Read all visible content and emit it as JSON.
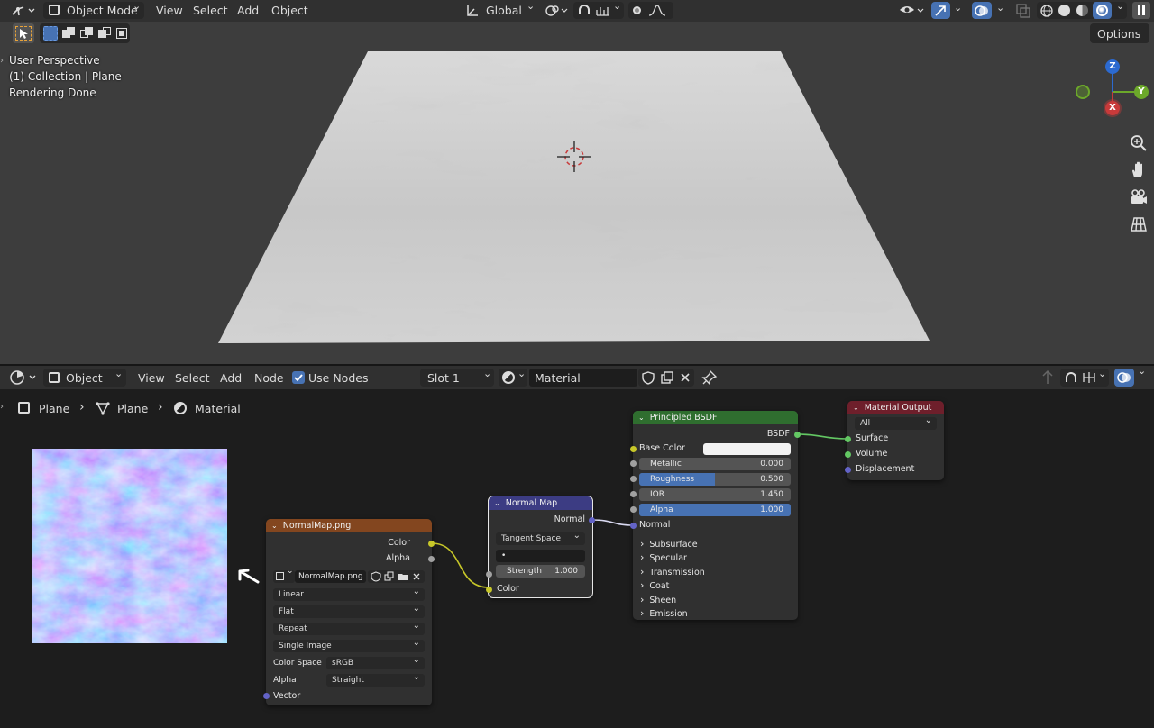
{
  "viewport": {
    "header": {
      "mode": "Object Mode",
      "menus": [
        "View",
        "Select",
        "Add",
        "Object"
      ],
      "transform_orientation": "Global"
    },
    "options_label": "Options",
    "overlay": {
      "perspective": "User Perspective",
      "collection": "(1) Collection | Plane",
      "status": "Rendering Done"
    },
    "gizmo": {
      "z": "Z",
      "y": "Y",
      "x": "X"
    }
  },
  "node_editor": {
    "header": {
      "editor_type": "Object",
      "menus": [
        "View",
        "Select",
        "Add",
        "Node"
      ],
      "use_nodes_label": "Use Nodes",
      "use_nodes_checked": true,
      "slot": "Slot 1",
      "material_name": "Material"
    },
    "breadcrumbs": [
      "Plane",
      "Plane",
      "Material"
    ],
    "nodes": {
      "image_texture": {
        "title": "NormalMap.png",
        "outputs": [
          "Color",
          "Alpha"
        ],
        "image_name": "NormalMap.png",
        "interpolation": "Linear",
        "projection": "Flat",
        "extension": "Repeat",
        "source": "Single Image",
        "color_space_label": "Color Space",
        "color_space": "sRGB",
        "alpha_label": "Alpha",
        "alpha_mode": "Straight",
        "input": "Vector"
      },
      "normal_map": {
        "title": "Normal Map",
        "output": "Normal",
        "space": "Tangent Space",
        "uv_map": "•",
        "strength_label": "Strength",
        "strength": "1.000",
        "input": "Color"
      },
      "principled": {
        "title": "Principled BSDF",
        "output": "BSDF",
        "base_color_label": "Base Color",
        "fields": [
          {
            "label": "Metallic",
            "value": "0.000",
            "fill": 0
          },
          {
            "label": "Roughness",
            "value": "0.500",
            "fill": 0.5
          },
          {
            "label": "IOR",
            "value": "1.450",
            "fill": 0
          },
          {
            "label": "Alpha",
            "value": "1.000",
            "fill": 1
          }
        ],
        "normal_label": "Normal",
        "panels": [
          "Subsurface",
          "Specular",
          "Transmission",
          "Coat",
          "Sheen",
          "Emission"
        ]
      },
      "material_output": {
        "title": "Material Output",
        "target": "All",
        "inputs": [
          "Surface",
          "Volume",
          "Displacement"
        ]
      }
    }
  },
  "colors": {
    "accent": "#4772b3",
    "texture_header": "#83461f",
    "vector_header": "#3c3c83",
    "shader_header": "#2f6e2f",
    "output_header": "#6e1f2b",
    "socket_color": "#c7c729",
    "socket_float": "#a1a1a1",
    "socket_vector": "#6363c7",
    "socket_shader": "#63c763"
  }
}
